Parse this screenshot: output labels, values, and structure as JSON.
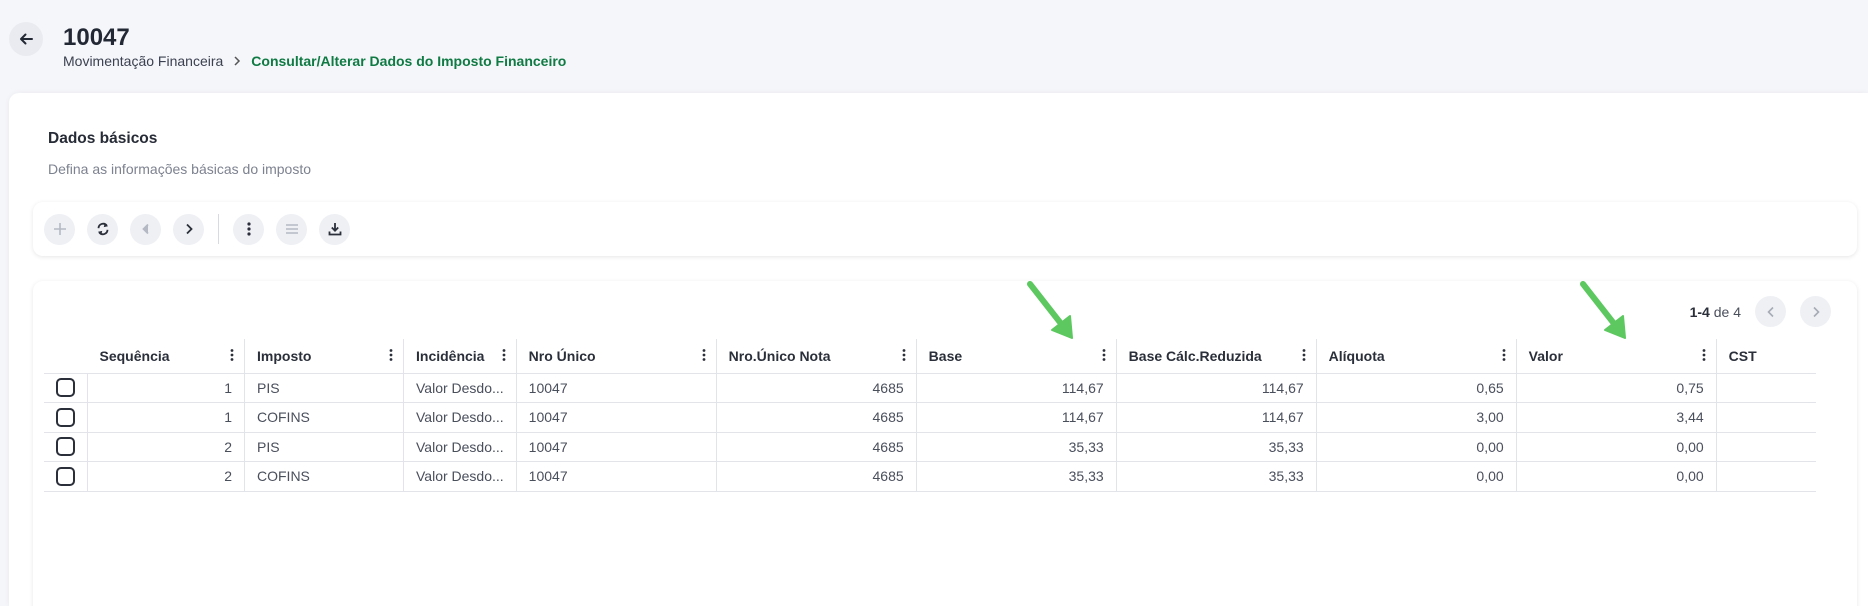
{
  "header": {
    "title": "10047",
    "breadcrumb": {
      "parent": "Movimentação Financeira",
      "current": "Consultar/Alterar Dados do Imposto Financeiro"
    }
  },
  "section": {
    "title": "Dados básicos",
    "subtitle": "Defina as informações básicas do imposto"
  },
  "toolbar": {
    "buttons": [
      {
        "icon": "plus-icon",
        "enabled": false
      },
      {
        "icon": "refresh-icon",
        "enabled": true
      },
      {
        "icon": "chevron-left-icon",
        "enabled": false
      },
      {
        "icon": "chevron-right-icon",
        "enabled": true
      },
      {
        "icon": "more-vertical-icon",
        "enabled": true
      },
      {
        "icon": "list-icon",
        "enabled": false
      },
      {
        "icon": "download-icon",
        "enabled": true
      }
    ]
  },
  "pager": {
    "range": "1-4",
    "of_label": "de",
    "total": "4"
  },
  "table": {
    "columns": [
      "Sequência",
      "Imposto",
      "Incidência",
      "Nro Único",
      "Nro.Único Nota",
      "Base",
      "Base Cálc.Reduzida",
      "Alíquota",
      "Valor",
      "CST"
    ],
    "rows": [
      {
        "seq": "1",
        "imposto": "PIS",
        "incidencia": "Valor Desdo...",
        "nro_unico": "10047",
        "nro_unico_nota": "4685",
        "base": "114,67",
        "base_reduzida": "114,67",
        "aliquota": "0,65",
        "valor": "0,75",
        "cst": ""
      },
      {
        "seq": "1",
        "imposto": "COFINS",
        "incidencia": "Valor Desdo...",
        "nro_unico": "10047",
        "nro_unico_nota": "4685",
        "base": "114,67",
        "base_reduzida": "114,67",
        "aliquota": "3,00",
        "valor": "3,44",
        "cst": ""
      },
      {
        "seq": "2",
        "imposto": "PIS",
        "incidencia": "Valor Desdo...",
        "nro_unico": "10047",
        "nro_unico_nota": "4685",
        "base": "35,33",
        "base_reduzida": "35,33",
        "aliquota": "0,00",
        "valor": "0,00",
        "cst": ""
      },
      {
        "seq": "2",
        "imposto": "COFINS",
        "incidencia": "Valor Desdo...",
        "nro_unico": "10047",
        "nro_unico_nota": "4685",
        "base": "35,33",
        "base_reduzida": "35,33",
        "aliquota": "0,00",
        "valor": "0,00",
        "cst": ""
      }
    ]
  },
  "colors": {
    "accent_green": "#0f7a43",
    "annotation_arrow": "#5cc85f"
  }
}
